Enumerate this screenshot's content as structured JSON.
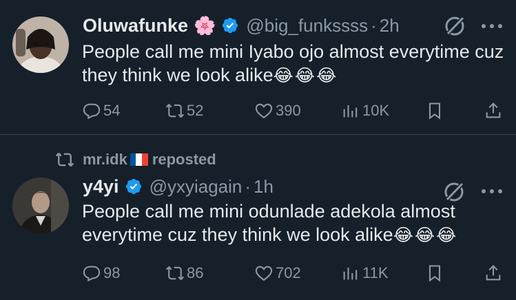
{
  "colors": {
    "background": "#15202b",
    "text_primary": "#e7e9ea",
    "text_secondary": "#8b98a5",
    "verified": "#1d9bf0"
  },
  "tweets": [
    {
      "display_name": "Oluwafunke",
      "name_emoji": "🌸",
      "handle": "@big_funkssss",
      "separator": "·",
      "time": "2h",
      "text": "People call me mini Iyabo ojo almost everytime cuz they think we look alike",
      "emojis": "😂😂😂",
      "replies": "54",
      "reposts": "52",
      "likes": "390",
      "views": "10K",
      "icons": [
        "reply-icon",
        "repost-icon",
        "like-icon",
        "views-icon",
        "bookmark-icon",
        "share-icon",
        "grok-icon",
        "more-icon",
        "verified-badge-icon"
      ]
    },
    {
      "repost_banner": {
        "user": "mr.idk",
        "label": "reposted",
        "flag": "france-flag"
      },
      "display_name": "y4yi",
      "handle": "@yxyiagain",
      "separator": "·",
      "time": "1h",
      "text": "People call me mini odunlade adekola almost everytime cuz they think we look alike",
      "emojis": "😂😂😂",
      "replies": "98",
      "reposts": "86",
      "likes": "702",
      "views": "11K"
    }
  ]
}
